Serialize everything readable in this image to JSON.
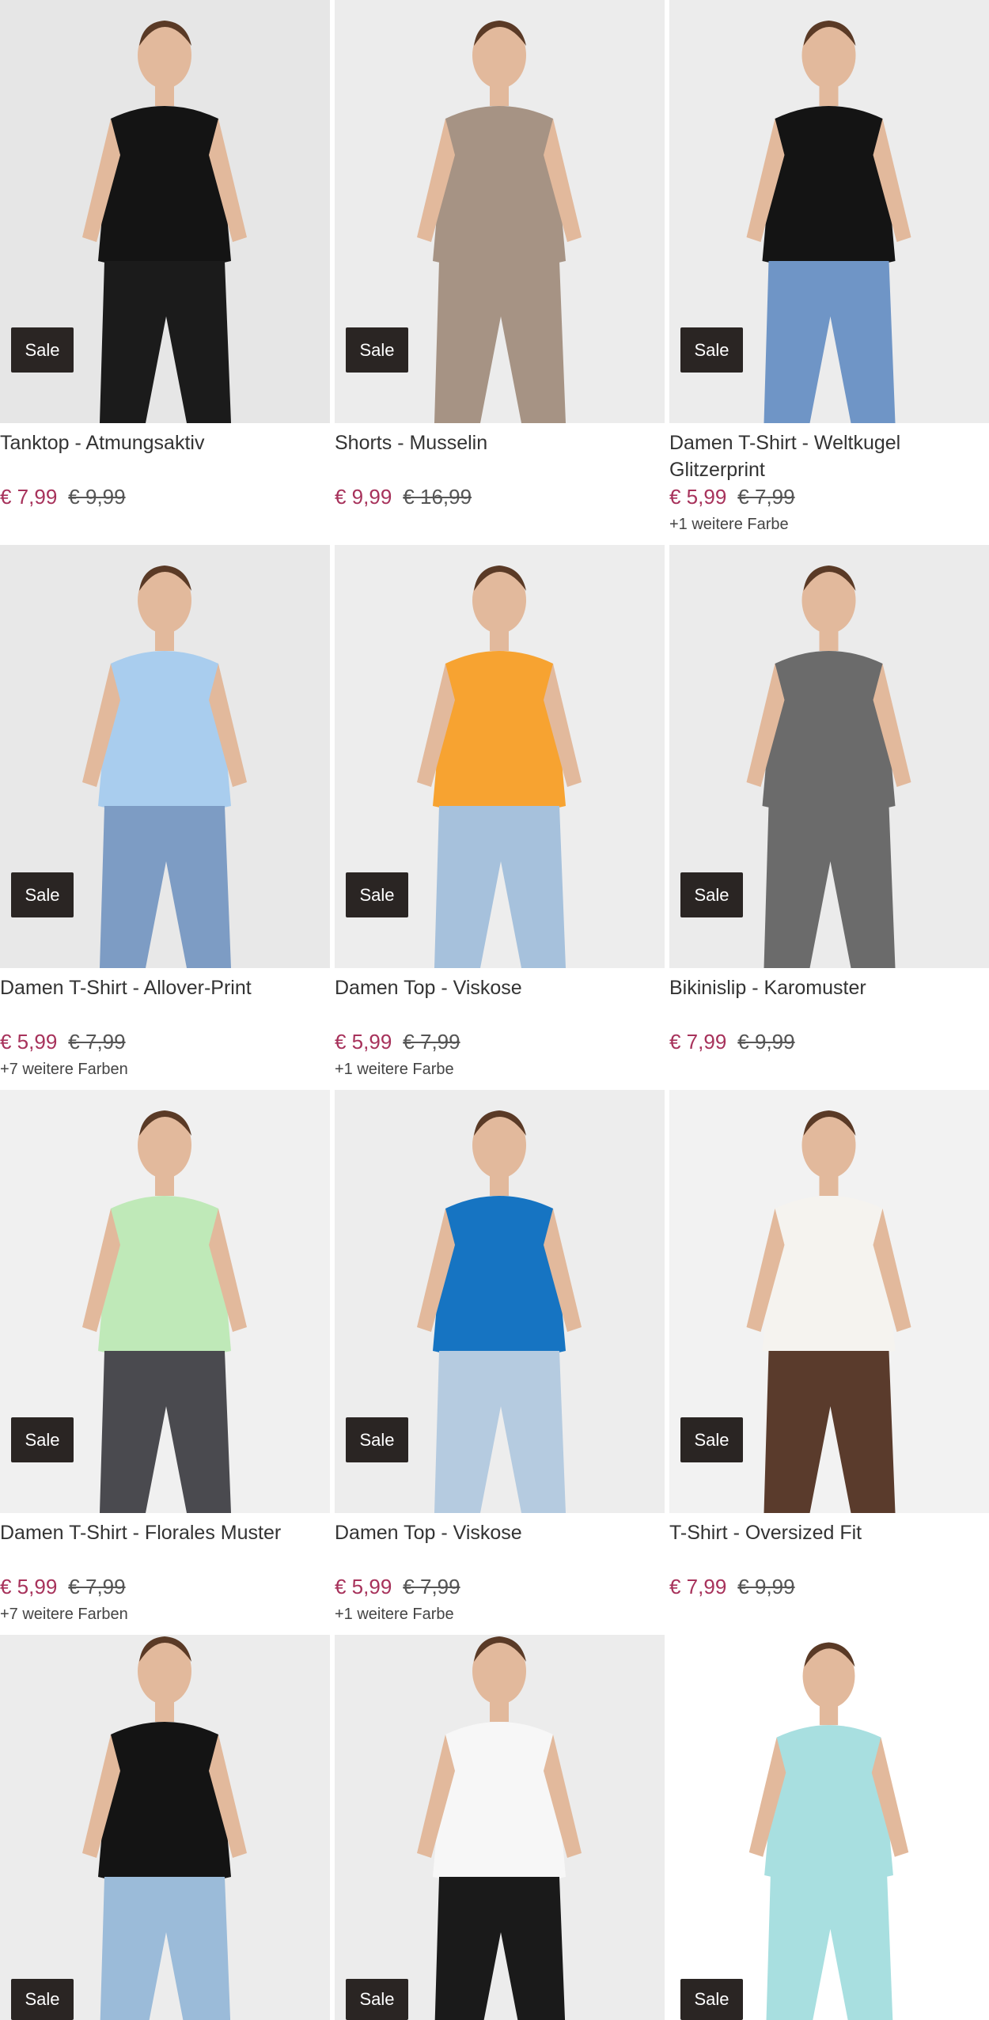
{
  "products": [
    {
      "title": "Tanktop - Atmungsaktiv",
      "price": "€ 7,99",
      "old_price": "€ 9,99",
      "colors": "",
      "badge": "Sale",
      "bg": "#e6e6e6",
      "garment": "#141414",
      "pants": "#1b1b1b"
    },
    {
      "title": "Shorts - Musselin",
      "price": "€ 9,99",
      "old_price": "€ 16,99",
      "colors": "",
      "badge": "Sale",
      "bg": "#ececec",
      "garment": "#a69384",
      "pants": "#a69384"
    },
    {
      "title": "Damen T-Shirt - Weltkugel Glitzerprint",
      "price": "€ 5,99",
      "old_price": "€ 7,99",
      "colors": "+1 weitere Farbe",
      "badge": "Sale",
      "bg": "#ececec",
      "garment": "#141414",
      "pants": "#6f95c6"
    },
    {
      "title": "Damen T-Shirt - Allover-Print",
      "price": "€ 5,99",
      "old_price": "€ 7,99",
      "colors": "+7 weitere Farben",
      "badge": "Sale",
      "bg": "#e8e8e8",
      "garment": "#a9cdee",
      "pants": "#7d9cc4"
    },
    {
      "title": "Damen Top - Viskose",
      "price": "€ 5,99",
      "old_price": "€ 7,99",
      "colors": "+1 weitere Farbe",
      "badge": "Sale",
      "bg": "#ededed",
      "garment": "#f7a331",
      "pants": "#a6c1dc"
    },
    {
      "title": "Bikinislip - Karomuster",
      "price": "€ 7,99",
      "old_price": "€ 9,99",
      "colors": "",
      "badge": "Sale",
      "bg": "#ebebeb",
      "garment": "#6b6b6b",
      "pants": "#6b6b6b"
    },
    {
      "title": "Damen T-Shirt - Florales Muster",
      "price": "€ 5,99",
      "old_price": "€ 7,99",
      "colors": "+7 weitere Farben",
      "badge": "Sale",
      "bg": "#f0f0f0",
      "garment": "#bfe9b8",
      "pants": "#4a4a4f"
    },
    {
      "title": "Damen Top - Viskose",
      "price": "€ 5,99",
      "old_price": "€ 7,99",
      "colors": "+1 weitere Farbe",
      "badge": "Sale",
      "bg": "#ededed",
      "garment": "#1674c2",
      "pants": "#b5cbe0"
    },
    {
      "title": "T-Shirt - Oversized Fit",
      "price": "€ 7,99",
      "old_price": "€ 9,99",
      "colors": "",
      "badge": "Sale",
      "bg": "#f2f2f2",
      "garment": "#f5f3ef",
      "pants": "#5a3b2c"
    },
    {
      "title": "",
      "price": "",
      "old_price": "",
      "colors": "",
      "badge": "Sale",
      "bg": "#ececec",
      "garment": "#141414",
      "pants": "#9bbbd9"
    },
    {
      "title": "",
      "price": "",
      "old_price": "",
      "colors": "",
      "badge": "Sale",
      "bg": "#ececec",
      "garment": "#f7f7f7",
      "pants": "#1a1a1a"
    },
    {
      "title": "",
      "price": "",
      "old_price": "",
      "colors": "",
      "badge": "Sale",
      "bg": "#ffffff",
      "garment": "#a8dfe0",
      "pants": "#a8dfe0"
    }
  ]
}
